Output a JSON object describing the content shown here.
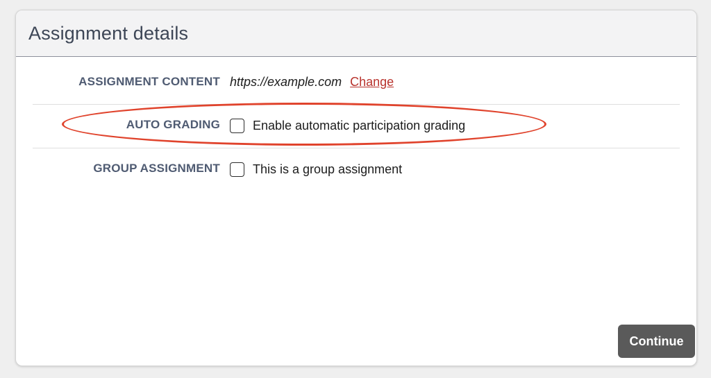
{
  "header": {
    "title": "Assignment details"
  },
  "rows": {
    "content": {
      "label": "ASSIGNMENT CONTENT",
      "url": "https://example.com",
      "change_label": "Change"
    },
    "auto_grading": {
      "label": "AUTO GRADING",
      "checkbox_label": "Enable automatic participation grading",
      "checked": false
    },
    "group_assignment": {
      "label": "GROUP ASSIGNMENT",
      "checkbox_label": "This is a group assignment",
      "checked": false
    }
  },
  "footer": {
    "continue_label": "Continue"
  },
  "colors": {
    "label": "#4f5b72",
    "link": "#b8322c",
    "highlight": "#e0432c",
    "button_bg": "#5a5a5a"
  }
}
